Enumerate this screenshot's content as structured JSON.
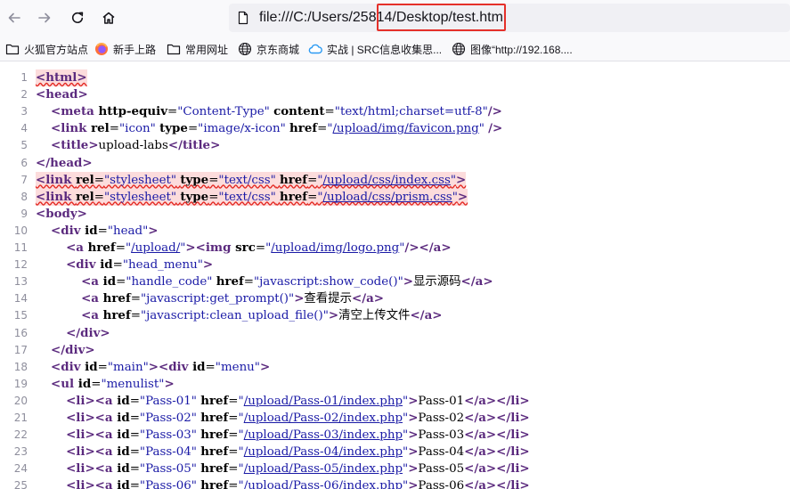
{
  "toolbar": {
    "back_icon": "arrow-left-icon",
    "forward_icon": "arrow-right-icon",
    "reload_icon": "reload-icon",
    "home_icon": "home-icon",
    "url": "file:///C:/Users/25814/Desktop/test.html",
    "highlight_color": "#e5302a"
  },
  "bookmarks": [
    {
      "label": "火狐官方站点",
      "icon": "folder-icon"
    },
    {
      "label": "新手上路",
      "icon": "firefox-icon"
    },
    {
      "label": "常用网址",
      "icon": "folder-icon"
    },
    {
      "label": "京东商城",
      "icon": "globe-icon"
    },
    {
      "label": "实战 | SRC信息收集思...",
      "icon": "cloud-icon"
    },
    {
      "label": "图像“http://192.168....",
      "icon": "globe-icon"
    }
  ],
  "source": {
    "lines": [
      {
        "num": "1",
        "error": true,
        "tokens": [
          [
            "tag",
            "<html>"
          ]
        ]
      },
      {
        "num": "2",
        "error": false,
        "tokens": [
          [
            "tag",
            "<head>"
          ]
        ]
      },
      {
        "num": "3",
        "error": false,
        "tokens": [
          [
            "txt",
            "    "
          ],
          [
            "tag",
            "<meta "
          ],
          [
            "attr",
            "http-equiv"
          ],
          [
            "txt",
            "="
          ],
          [
            "val",
            "\"Content-Type\""
          ],
          [
            "txt",
            " "
          ],
          [
            "attr",
            "content"
          ],
          [
            "txt",
            "="
          ],
          [
            "val",
            "\"text/html;charset=utf-8\""
          ],
          [
            "tag",
            "/>"
          ]
        ]
      },
      {
        "num": "4",
        "error": false,
        "tokens": [
          [
            "txt",
            "    "
          ],
          [
            "tag",
            "<link "
          ],
          [
            "attr",
            "rel"
          ],
          [
            "txt",
            "="
          ],
          [
            "val",
            "\"icon\""
          ],
          [
            "txt",
            " "
          ],
          [
            "attr",
            "type"
          ],
          [
            "txt",
            "="
          ],
          [
            "val",
            "\"image/x-icon\""
          ],
          [
            "txt",
            " "
          ],
          [
            "attr",
            "href"
          ],
          [
            "txt",
            "="
          ],
          [
            "val",
            "\""
          ],
          [
            "lnk",
            "/upload/img/favicon.png"
          ],
          [
            "val",
            "\""
          ],
          [
            "txt",
            " "
          ],
          [
            "tag",
            "/>"
          ]
        ]
      },
      {
        "num": "5",
        "error": false,
        "tokens": [
          [
            "txt",
            "    "
          ],
          [
            "tag",
            "<title>"
          ],
          [
            "txt",
            "upload-labs"
          ],
          [
            "tag",
            "</title>"
          ]
        ]
      },
      {
        "num": "6",
        "error": false,
        "tokens": [
          [
            "tag",
            "</head>"
          ]
        ]
      },
      {
        "num": "7",
        "error": true,
        "tokens": [
          [
            "tag",
            "<link "
          ],
          [
            "attr",
            "rel"
          ],
          [
            "txt",
            "="
          ],
          [
            "val",
            "\"stylesheet\""
          ],
          [
            "txt",
            " "
          ],
          [
            "attr",
            "type"
          ],
          [
            "txt",
            "="
          ],
          [
            "val",
            "\"text/css\""
          ],
          [
            "txt",
            " "
          ],
          [
            "attr",
            "href"
          ],
          [
            "txt",
            "="
          ],
          [
            "val",
            "\""
          ],
          [
            "lnk",
            "/upload/css/index.css"
          ],
          [
            "val",
            "\""
          ],
          [
            "tag",
            ">"
          ]
        ]
      },
      {
        "num": "8",
        "error": true,
        "tokens": [
          [
            "tag",
            "<link "
          ],
          [
            "attr",
            "rel"
          ],
          [
            "txt",
            "="
          ],
          [
            "val",
            "\"stylesheet\""
          ],
          [
            "txt",
            " "
          ],
          [
            "attr",
            "type"
          ],
          [
            "txt",
            "="
          ],
          [
            "val",
            "\"text/css\""
          ],
          [
            "txt",
            " "
          ],
          [
            "attr",
            "href"
          ],
          [
            "txt",
            "="
          ],
          [
            "val",
            "\""
          ],
          [
            "lnk",
            "/upload/css/prism.css"
          ],
          [
            "val",
            "\""
          ],
          [
            "tag",
            ">"
          ]
        ]
      },
      {
        "num": "9",
        "error": false,
        "tokens": [
          [
            "tag",
            "<body>"
          ]
        ]
      },
      {
        "num": "10",
        "error": false,
        "tokens": [
          [
            "txt",
            "    "
          ],
          [
            "tag",
            "<div "
          ],
          [
            "attr",
            "id"
          ],
          [
            "txt",
            "="
          ],
          [
            "val",
            "\"head\""
          ],
          [
            "tag",
            ">"
          ]
        ]
      },
      {
        "num": "11",
        "error": false,
        "tokens": [
          [
            "txt",
            "        "
          ],
          [
            "tag",
            "<a "
          ],
          [
            "attr",
            "href"
          ],
          [
            "txt",
            "="
          ],
          [
            "val",
            "\""
          ],
          [
            "lnk",
            "/upload/"
          ],
          [
            "val",
            "\""
          ],
          [
            "tag",
            "><img "
          ],
          [
            "attr",
            "src"
          ],
          [
            "txt",
            "="
          ],
          [
            "val",
            "\""
          ],
          [
            "lnk",
            "/upload/img/logo.png"
          ],
          [
            "val",
            "\""
          ],
          [
            "tag",
            "/></a>"
          ]
        ]
      },
      {
        "num": "12",
        "error": false,
        "tokens": [
          [
            "txt",
            "        "
          ],
          [
            "tag",
            "<div "
          ],
          [
            "attr",
            "id"
          ],
          [
            "txt",
            "="
          ],
          [
            "val",
            "\"head_menu\""
          ],
          [
            "tag",
            ">"
          ]
        ]
      },
      {
        "num": "13",
        "error": false,
        "tokens": [
          [
            "txt",
            "            "
          ],
          [
            "tag",
            "<a "
          ],
          [
            "attr",
            "id"
          ],
          [
            "txt",
            "="
          ],
          [
            "val",
            "\"handle_code\""
          ],
          [
            "txt",
            " "
          ],
          [
            "attr",
            "href"
          ],
          [
            "txt",
            "="
          ],
          [
            "val",
            "\"javascript:show_code()\""
          ],
          [
            "tag",
            ">"
          ],
          [
            "txt",
            "显示源码"
          ],
          [
            "tag",
            "</a>"
          ]
        ]
      },
      {
        "num": "14",
        "error": false,
        "tokens": [
          [
            "txt",
            "            "
          ],
          [
            "tag",
            "<a "
          ],
          [
            "attr",
            "href"
          ],
          [
            "txt",
            "="
          ],
          [
            "val",
            "\"javascript:get_prompt()\""
          ],
          [
            "tag",
            ">"
          ],
          [
            "txt",
            "查看提示"
          ],
          [
            "tag",
            "</a>"
          ]
        ]
      },
      {
        "num": "15",
        "error": false,
        "tokens": [
          [
            "txt",
            "            "
          ],
          [
            "tag",
            "<a "
          ],
          [
            "attr",
            "href"
          ],
          [
            "txt",
            "="
          ],
          [
            "val",
            "\"javascript:clean_upload_file()\""
          ],
          [
            "tag",
            ">"
          ],
          [
            "txt",
            "清空上传文件"
          ],
          [
            "tag",
            "</a>"
          ]
        ]
      },
      {
        "num": "16",
        "error": false,
        "tokens": [
          [
            "txt",
            "        "
          ],
          [
            "tag",
            "</div>"
          ]
        ]
      },
      {
        "num": "17",
        "error": false,
        "tokens": [
          [
            "txt",
            "    "
          ],
          [
            "tag",
            "</div>"
          ]
        ]
      },
      {
        "num": "18",
        "error": false,
        "tokens": [
          [
            "txt",
            "    "
          ],
          [
            "tag",
            "<div "
          ],
          [
            "attr",
            "id"
          ],
          [
            "txt",
            "="
          ],
          [
            "val",
            "\"main\""
          ],
          [
            "tag",
            "><div "
          ],
          [
            "attr",
            "id"
          ],
          [
            "txt",
            "="
          ],
          [
            "val",
            "\"menu\""
          ],
          [
            "tag",
            ">"
          ]
        ]
      },
      {
        "num": "19",
        "error": false,
        "tokens": [
          [
            "txt",
            "    "
          ],
          [
            "tag",
            "<ul "
          ],
          [
            "attr",
            "id"
          ],
          [
            "txt",
            "="
          ],
          [
            "val",
            "\"menulist\""
          ],
          [
            "tag",
            ">"
          ]
        ]
      },
      {
        "num": "20",
        "error": false,
        "tokens": [
          [
            "txt",
            "        "
          ],
          [
            "tag",
            "<li><a "
          ],
          [
            "attr",
            "id"
          ],
          [
            "txt",
            "="
          ],
          [
            "val",
            "\"Pass-01\""
          ],
          [
            "txt",
            " "
          ],
          [
            "attr",
            "href"
          ],
          [
            "txt",
            "="
          ],
          [
            "val",
            "\""
          ],
          [
            "lnk",
            "/upload/Pass-01/index.php"
          ],
          [
            "val",
            "\""
          ],
          [
            "tag",
            ">"
          ],
          [
            "txt",
            "Pass-01"
          ],
          [
            "tag",
            "</a></li>"
          ]
        ]
      },
      {
        "num": "21",
        "error": false,
        "tokens": [
          [
            "txt",
            "        "
          ],
          [
            "tag",
            "<li><a "
          ],
          [
            "attr",
            "id"
          ],
          [
            "txt",
            "="
          ],
          [
            "val",
            "\"Pass-02\""
          ],
          [
            "txt",
            " "
          ],
          [
            "attr",
            "href"
          ],
          [
            "txt",
            "="
          ],
          [
            "val",
            "\""
          ],
          [
            "lnk",
            "/upload/Pass-02/index.php"
          ],
          [
            "val",
            "\""
          ],
          [
            "tag",
            ">"
          ],
          [
            "txt",
            "Pass-02"
          ],
          [
            "tag",
            "</a></li>"
          ]
        ]
      },
      {
        "num": "22",
        "error": false,
        "tokens": [
          [
            "txt",
            "        "
          ],
          [
            "tag",
            "<li><a "
          ],
          [
            "attr",
            "id"
          ],
          [
            "txt",
            "="
          ],
          [
            "val",
            "\"Pass-03\""
          ],
          [
            "txt",
            " "
          ],
          [
            "attr",
            "href"
          ],
          [
            "txt",
            "="
          ],
          [
            "val",
            "\""
          ],
          [
            "lnk",
            "/upload/Pass-03/index.php"
          ],
          [
            "val",
            "\""
          ],
          [
            "tag",
            ">"
          ],
          [
            "txt",
            "Pass-03"
          ],
          [
            "tag",
            "</a></li>"
          ]
        ]
      },
      {
        "num": "23",
        "error": false,
        "tokens": [
          [
            "txt",
            "        "
          ],
          [
            "tag",
            "<li><a "
          ],
          [
            "attr",
            "id"
          ],
          [
            "txt",
            "="
          ],
          [
            "val",
            "\"Pass-04\""
          ],
          [
            "txt",
            " "
          ],
          [
            "attr",
            "href"
          ],
          [
            "txt",
            "="
          ],
          [
            "val",
            "\""
          ],
          [
            "lnk",
            "/upload/Pass-04/index.php"
          ],
          [
            "val",
            "\""
          ],
          [
            "tag",
            ">"
          ],
          [
            "txt",
            "Pass-04"
          ],
          [
            "tag",
            "</a></li>"
          ]
        ]
      },
      {
        "num": "24",
        "error": false,
        "tokens": [
          [
            "txt",
            "        "
          ],
          [
            "tag",
            "<li><a "
          ],
          [
            "attr",
            "id"
          ],
          [
            "txt",
            "="
          ],
          [
            "val",
            "\"Pass-05\""
          ],
          [
            "txt",
            " "
          ],
          [
            "attr",
            "href"
          ],
          [
            "txt",
            "="
          ],
          [
            "val",
            "\""
          ],
          [
            "lnk",
            "/upload/Pass-05/index.php"
          ],
          [
            "val",
            "\""
          ],
          [
            "tag",
            ">"
          ],
          [
            "txt",
            "Pass-05"
          ],
          [
            "tag",
            "</a></li>"
          ]
        ]
      },
      {
        "num": "25",
        "error": false,
        "tokens": [
          [
            "txt",
            "        "
          ],
          [
            "tag",
            "<li><a "
          ],
          [
            "attr",
            "id"
          ],
          [
            "txt",
            "="
          ],
          [
            "val",
            "\"Pass-06\""
          ],
          [
            "txt",
            " "
          ],
          [
            "attr",
            "href"
          ],
          [
            "txt",
            "="
          ],
          [
            "val",
            "\""
          ],
          [
            "lnk",
            "/upload/Pass-06/index.php"
          ],
          [
            "val",
            "\""
          ],
          [
            "tag",
            ">"
          ],
          [
            "txt",
            "Pass-06"
          ],
          [
            "tag",
            "</a></li>"
          ]
        ]
      }
    ]
  }
}
